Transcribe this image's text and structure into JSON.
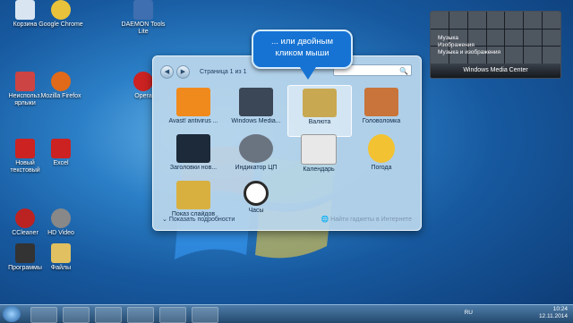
{
  "desktop": {
    "icons": [
      {
        "label": "Корзина",
        "color": "#d9e6f2"
      },
      {
        "label": "Google Chrome",
        "color": "#e8c23a"
      },
      {
        "label": "DAEMON Tools Lite",
        "color": "#3f6fb0"
      },
      {
        "label": "Неиспольз. ярлыки",
        "color": "#c44"
      },
      {
        "label": "Mozilla Firefox",
        "color": "#e06a1a"
      },
      {
        "label": "Opera",
        "color": "#c22"
      },
      {
        "label": "Новый текстовый",
        "color": "#c22"
      },
      {
        "label": "Excel",
        "color": "#c22"
      },
      {
        "label": "CCleaner",
        "color": "#b22"
      },
      {
        "label": "HD Video",
        "color": "#888"
      },
      {
        "label": "Программы",
        "color": "#333"
      },
      {
        "label": "Файлы",
        "color": "#e0c060"
      }
    ]
  },
  "gadget_window": {
    "page_label": "Страница 1 из 1",
    "search_placeholder": "🔍",
    "gadgets": [
      {
        "label": "Avast! antivirus ...",
        "color": "#f08a1c"
      },
      {
        "label": "Windows Media...",
        "color": "#3b4656"
      },
      {
        "label": "Валюта",
        "color": "#c8a850"
      },
      {
        "label": "Головоломка",
        "color": "#c8743a"
      },
      {
        "label": "Заголовки нов...",
        "color": "#1c2a3a"
      },
      {
        "label": "Индикатор ЦП",
        "color": "#6a7480"
      },
      {
        "label": "Календарь",
        "color": "#e8e8e8"
      },
      {
        "label": "Погода",
        "color": "#f2c232"
      },
      {
        "label": "Показ слайдов",
        "color": "#d8b040"
      },
      {
        "label": "Часы",
        "color": "#2a2a2a"
      }
    ],
    "show_details": "Показать подробности",
    "find_online": "Найти гаджеты в Интернете"
  },
  "callout": {
    "line1": "... или двойным",
    "line2": "кликом мыши"
  },
  "media_center": {
    "menu": [
      "Музыка",
      "Изображения",
      "Музыка и изображения"
    ],
    "title": "Windows Media Center"
  },
  "taskbar": {
    "time": "10:24",
    "date": "12.11.2014",
    "lang": "RU"
  }
}
